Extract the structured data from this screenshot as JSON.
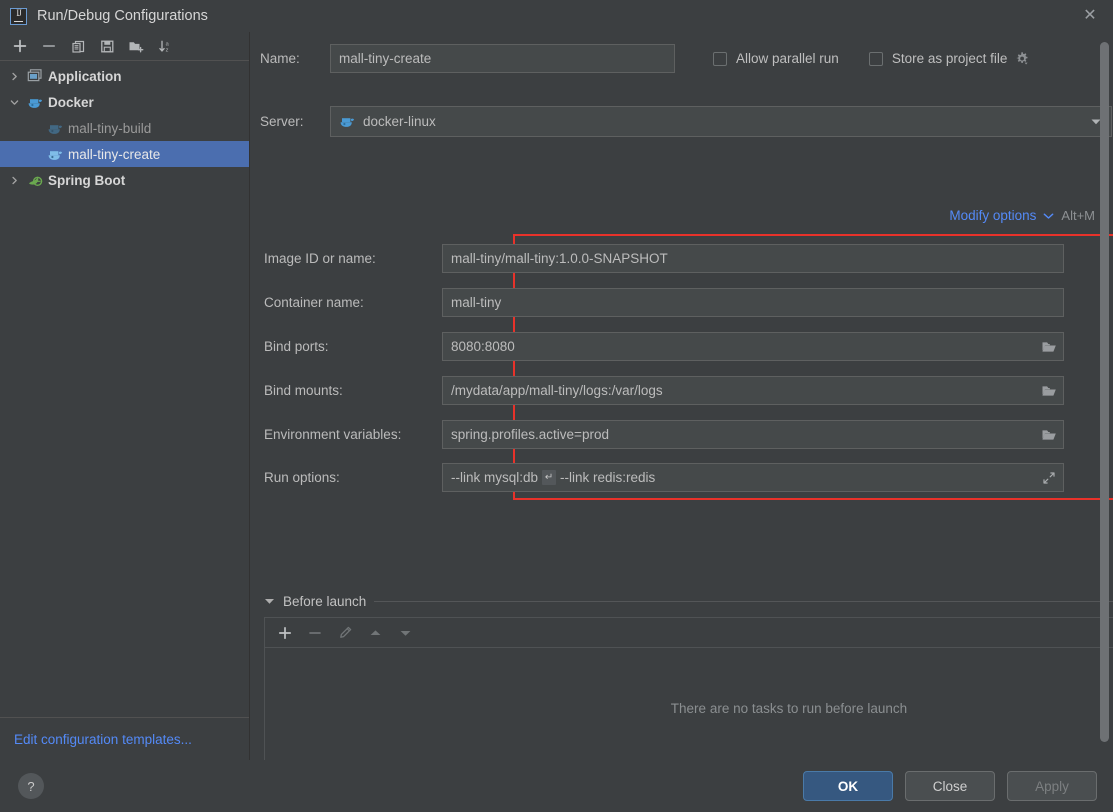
{
  "window": {
    "title": "Run/Debug Configurations",
    "app_icon": "intellij-idea-icon",
    "close_label": "✕"
  },
  "left_toolbar": {
    "items": [
      {
        "name": "add-configuration-button",
        "icon": "plus-icon",
        "tooltip": "Add New Configuration"
      },
      {
        "name": "remove-configuration-button",
        "icon": "minus-icon",
        "tooltip": "Remove Configuration"
      },
      {
        "name": "copy-configuration-button",
        "icon": "copy-icon",
        "tooltip": "Copy Configuration"
      },
      {
        "name": "save-configuration-button",
        "icon": "save-icon",
        "tooltip": "Save Configuration"
      },
      {
        "name": "move-into-folder-button",
        "icon": "folder-add-icon",
        "tooltip": "Move into new folder"
      },
      {
        "name": "sort-configurations-button",
        "icon": "sort-az-icon",
        "tooltip": "Sort Configurations"
      }
    ]
  },
  "tree": {
    "nodes": [
      {
        "label": "Application",
        "type": "group",
        "icon": "application-icon",
        "expanded": false,
        "selected": false,
        "indent": 0
      },
      {
        "label": "Docker",
        "type": "group",
        "icon": "docker-icon",
        "expanded": true,
        "selected": false,
        "indent": 0
      },
      {
        "label": "mall-tiny-build",
        "type": "config",
        "icon": "docker-icon-dim",
        "selected": false,
        "indent": 1
      },
      {
        "label": "mall-tiny-create",
        "type": "config",
        "icon": "docker-icon",
        "selected": true,
        "indent": 1
      },
      {
        "label": "Spring Boot",
        "type": "group",
        "icon": "spring-boot-icon",
        "expanded": false,
        "selected": false,
        "indent": 0
      }
    ]
  },
  "left_footer": {
    "edit_templates_link": "Edit configuration templates..."
  },
  "form": {
    "name_label": "Name:",
    "name_value": "mall-tiny-create",
    "allow_parallel_run": {
      "label": "Allow parallel run",
      "checked": false
    },
    "store_as_project_file": {
      "label": "Store as project file",
      "checked": false,
      "gear_icon": "gear-icon"
    },
    "server_label": "Server:",
    "server_value": "docker-linux",
    "server_icon": "docker-icon",
    "server_browse_label": "...",
    "modify_options_link": "Modify options",
    "modify_options_shortcut": "Alt+M",
    "fields": [
      {
        "label": "Image ID or name:",
        "value": "mall-tiny/mall-tiny:1.0.0-SNAPSHOT",
        "trailing_icon": null,
        "name": "image-id-or-name"
      },
      {
        "label": "Container name:",
        "value": "mall-tiny",
        "trailing_icon": null,
        "name": "container-name"
      },
      {
        "label": "Bind ports:",
        "value": "8080:8080",
        "trailing_icon": "folder-icon",
        "name": "bind-ports"
      },
      {
        "label": "Bind mounts:",
        "value": "/mydata/app/mall-tiny/logs:/var/logs",
        "trailing_icon": "folder-icon",
        "name": "bind-mounts"
      },
      {
        "label": "Environment variables:",
        "value": "spring.profiles.active=prod",
        "trailing_icon": "folder-icon",
        "name": "environment-variables"
      },
      {
        "label": "Run options:",
        "value_before": "--link mysql:db",
        "value_return_mark": "↵",
        "value_after": "--link redis:redis",
        "trailing_icon": "expand-icon",
        "name": "run-options"
      }
    ]
  },
  "before_launch": {
    "title": "Before launch",
    "expanded": true,
    "toolbar": [
      {
        "name": "add-task-button",
        "icon": "plus-icon",
        "enabled": true
      },
      {
        "name": "remove-task-button",
        "icon": "minus-icon",
        "enabled": false
      },
      {
        "name": "edit-task-button",
        "icon": "pencil-icon",
        "enabled": false
      },
      {
        "name": "move-task-up-button",
        "icon": "arrow-up-icon",
        "enabled": false
      },
      {
        "name": "move-task-down-button",
        "icon": "arrow-down-icon",
        "enabled": false
      }
    ],
    "empty_message": "There are no tasks to run before launch"
  },
  "footer": {
    "help_label": "?",
    "ok_label": "OK",
    "close_label": "Close",
    "apply_label": "Apply",
    "apply_enabled": false
  },
  "colors": {
    "background": "#3c3f41",
    "field_background": "#45494a",
    "selection_blue": "#4b6eaf",
    "link_blue": "#548af7",
    "annotation_red": "#e8322a",
    "primary_button": "#365880",
    "docker_blue": "#4a9ad4",
    "spring_green": "#6aa84f"
  }
}
